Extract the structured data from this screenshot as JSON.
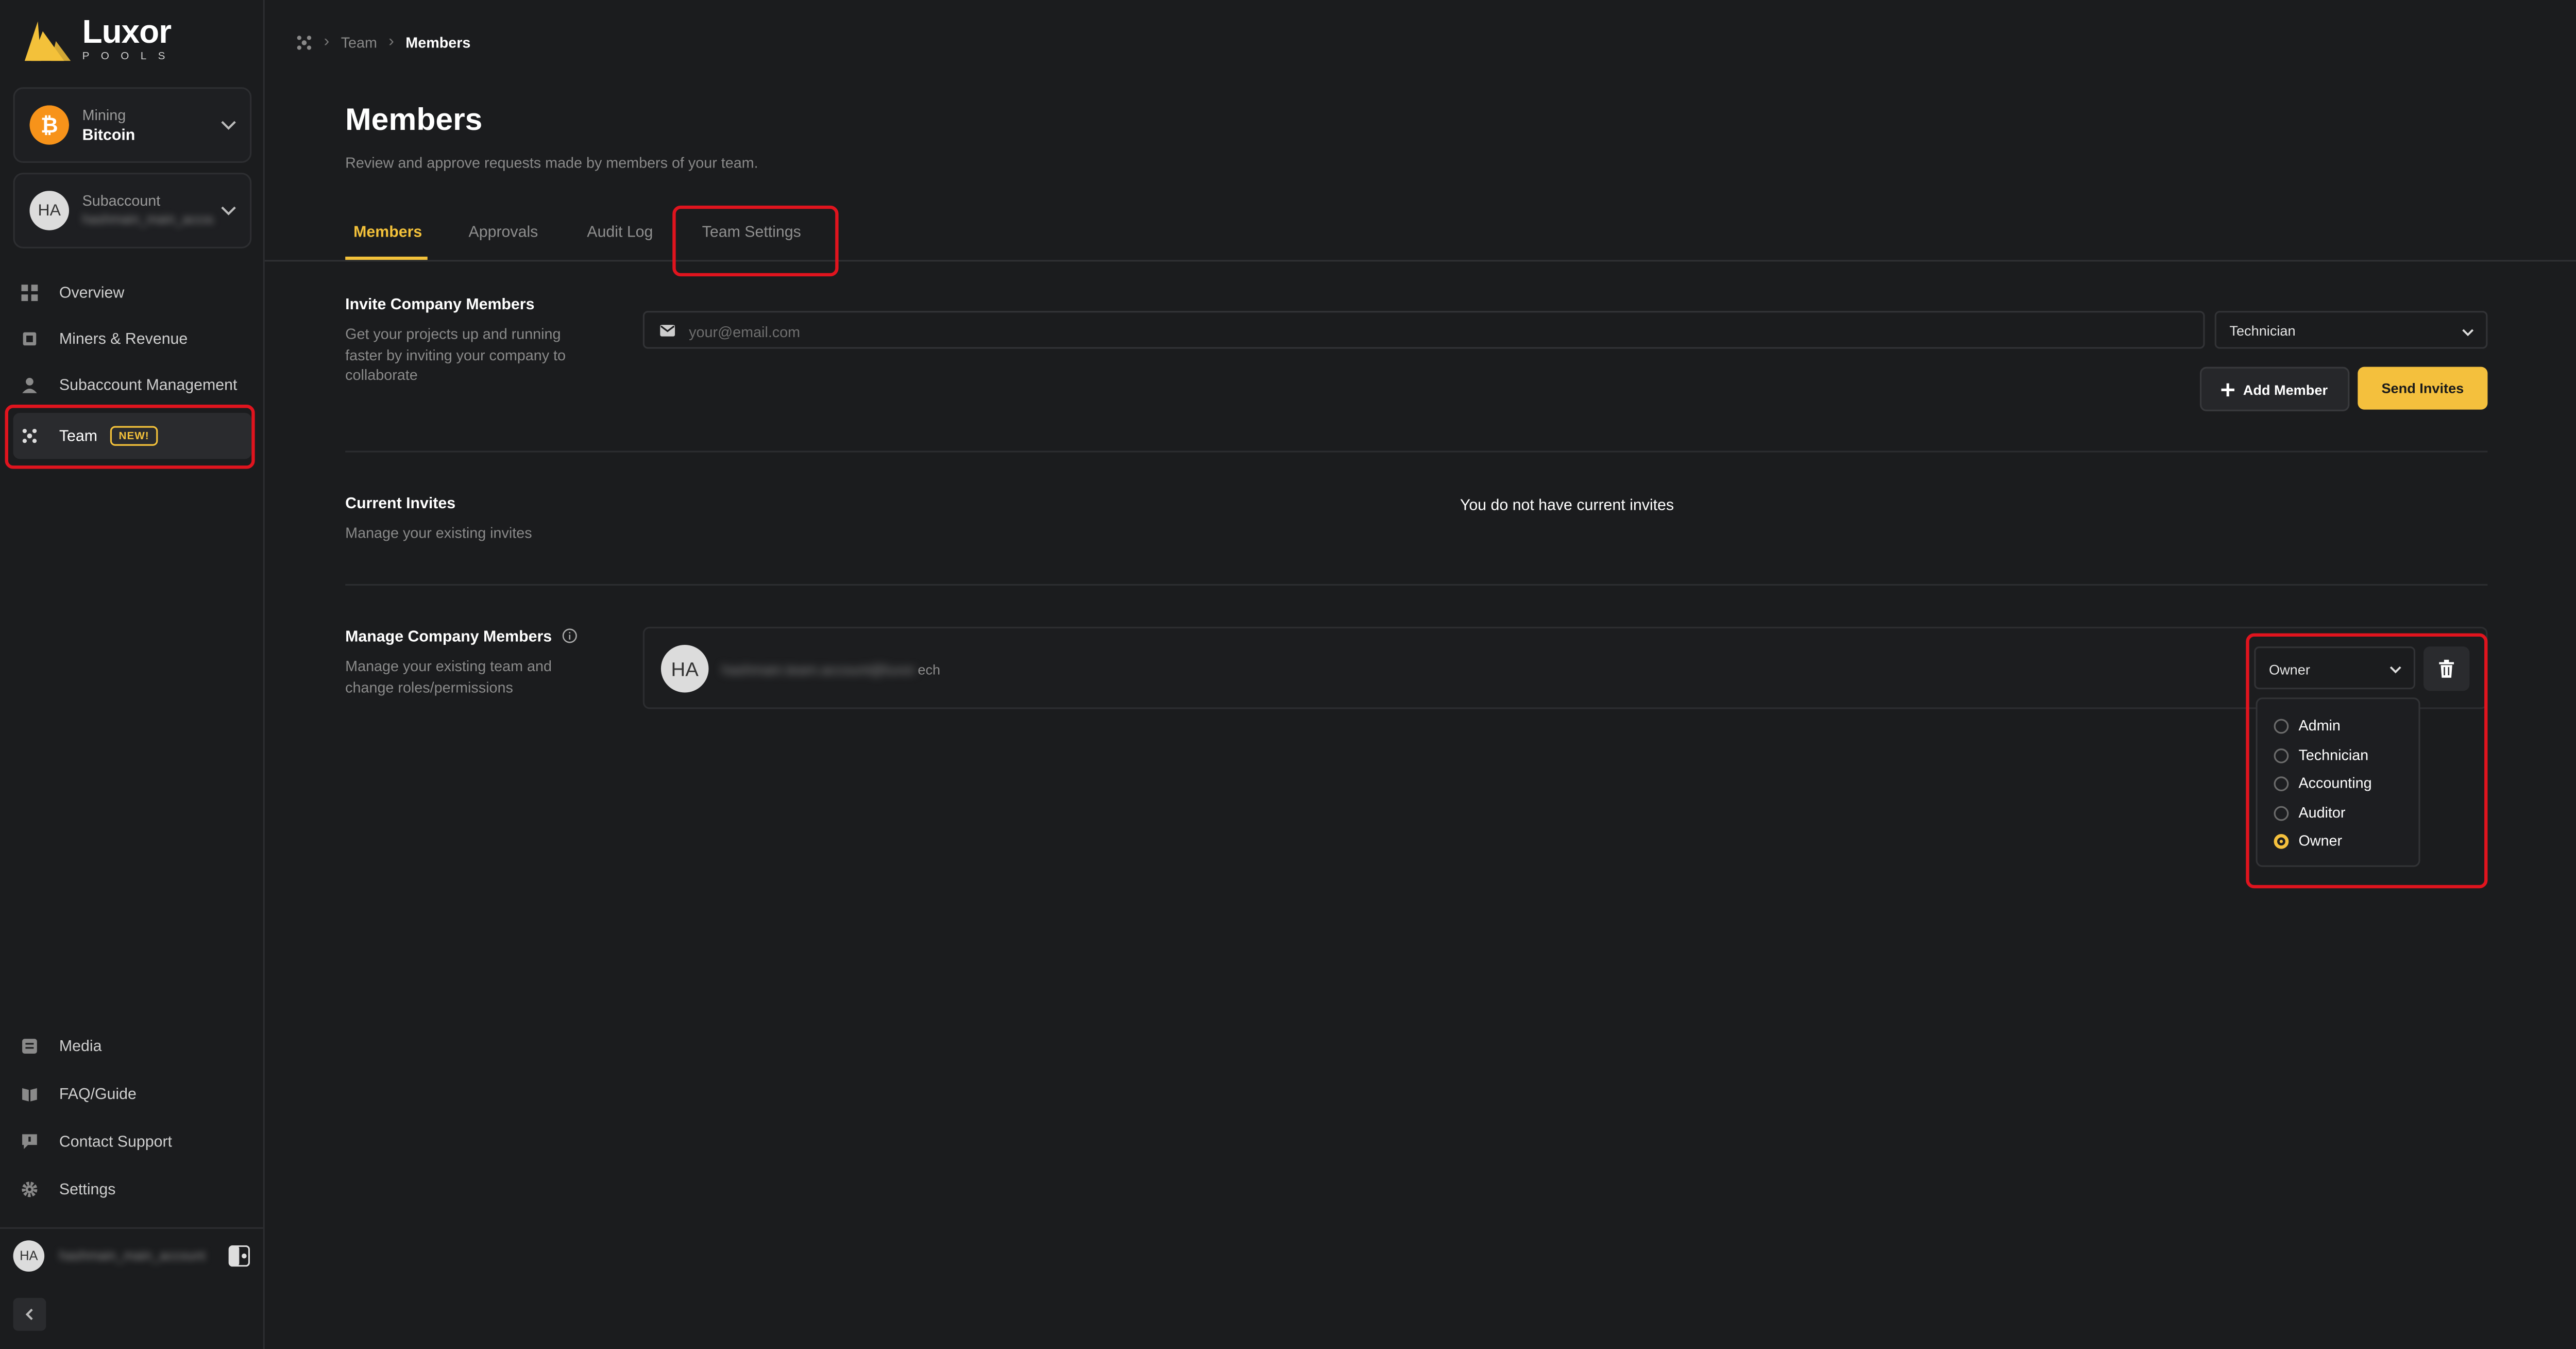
{
  "brand": {
    "name": "Luxor",
    "sub": "POOLS",
    "accent": "#f3c13a"
  },
  "sidebar": {
    "mining_card": {
      "label": "Mining",
      "value": "Bitcoin"
    },
    "subaccount_card": {
      "avatar": "HA",
      "label": "Subaccount",
      "value": "hashmain_main_account"
    },
    "nav": [
      {
        "label": "Overview"
      },
      {
        "label": "Miners & Revenue"
      },
      {
        "label": "Subaccount Management"
      },
      {
        "label": "Team",
        "badge": "NEW!"
      }
    ],
    "bottom_nav": [
      {
        "label": "Media"
      },
      {
        "label": "FAQ/Guide"
      },
      {
        "label": "Contact Support"
      },
      {
        "label": "Settings"
      }
    ],
    "user": {
      "avatar": "HA",
      "name": "hashmain_main_account"
    }
  },
  "breadcrumb": {
    "items": [
      "Team",
      "Members"
    ]
  },
  "page": {
    "title": "Members",
    "subtitle": "Review and approve requests made by members of your team."
  },
  "tabs": [
    {
      "label": "Members",
      "active": true
    },
    {
      "label": "Approvals",
      "active": false
    },
    {
      "label": "Audit Log",
      "active": false
    },
    {
      "label": "Team Settings",
      "active": false
    }
  ],
  "invite": {
    "title": "Invite Company Members",
    "desc": "Get your projects up and running faster by inviting your company to collaborate",
    "email_placeholder": "your@email.com",
    "role": "Technician",
    "add_label": "Add Member",
    "send_label": "Send Invites"
  },
  "current_invites": {
    "title": "Current Invites",
    "desc": "Manage your existing invites",
    "empty": "You do not have current invites"
  },
  "manage": {
    "title": "Manage Company Members",
    "desc": "Manage your existing team and change roles/permissions",
    "member": {
      "avatar": "HA",
      "email_hidden": "hashmain.team.account@luxor.",
      "email_suffix": "ech",
      "role": "Owner"
    },
    "role_options": [
      {
        "label": "Admin",
        "selected": false
      },
      {
        "label": "Technician",
        "selected": false
      },
      {
        "label": "Accounting",
        "selected": false
      },
      {
        "label": "Auditor",
        "selected": false
      },
      {
        "label": "Owner",
        "selected": true
      }
    ]
  }
}
